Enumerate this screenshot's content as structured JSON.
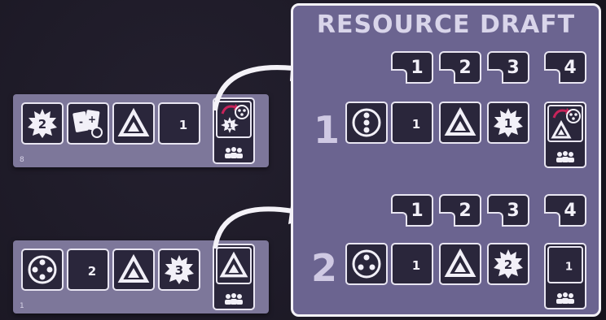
{
  "player_rows": [
    {
      "count": "8",
      "tiles": [
        "sun-2",
        "cards-plus-minus",
        "triangle",
        "moon-1"
      ],
      "final": "sun-1-swap"
    },
    {
      "count": "1",
      "tiles": [
        "dice-4",
        "moon-2",
        "triangle",
        "sun-3"
      ],
      "final": "triangle"
    }
  ],
  "draft": {
    "title": "RESOURCE DRAFT",
    "positions": [
      "1",
      "2",
      "3",
      "4"
    ],
    "rows": [
      {
        "number": "1",
        "tiles": [
          "dice-3",
          "moon-1",
          "triangle",
          "sun-1"
        ],
        "final": "triangle-swap"
      },
      {
        "number": "2",
        "tiles": [
          "dice-3",
          "moon-1",
          "triangle",
          "sun-2"
        ],
        "final": "moon-1"
      }
    ]
  },
  "colors": {
    "panel": "#7d779a",
    "tile": "#2a263b",
    "accent_arrow": "#c8235a",
    "draft_bg": "#6b6490"
  }
}
